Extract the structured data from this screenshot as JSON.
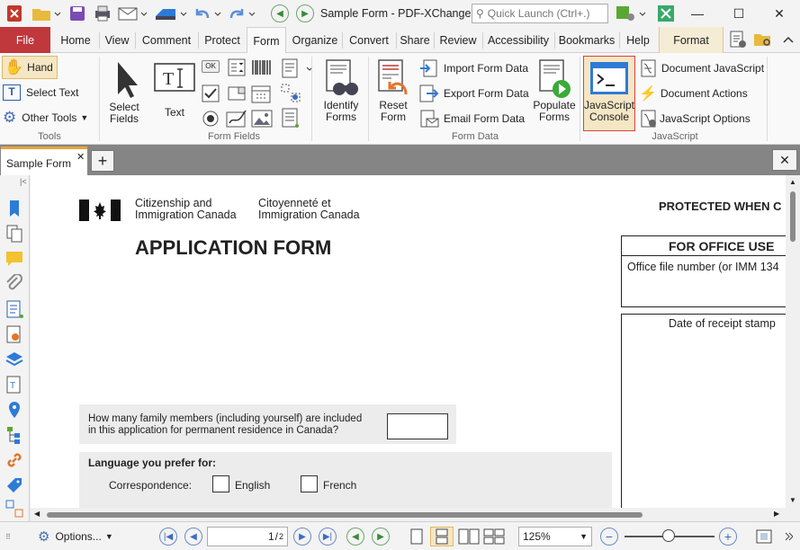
{
  "window": {
    "title": "Sample Form - PDF-XChange ..",
    "search_placeholder": "Quick Launch (Ctrl+.)"
  },
  "menu": {
    "file": "File",
    "home": "Home",
    "view": "View",
    "comment": "Comment",
    "protect": "Protect",
    "form": "Form",
    "organize": "Organize",
    "convert": "Convert",
    "share": "Share",
    "review": "Review",
    "accessibility": "Accessibility",
    "bookmarks": "Bookmarks",
    "help": "Help",
    "format": "Format"
  },
  "ribbon": {
    "tools": {
      "hand": "Hand",
      "select_text": "Select Text",
      "other_tools": "Other Tools",
      "group": "Tools"
    },
    "fields": {
      "select_fields_1": "Select",
      "select_fields_2": "Fields",
      "text": "Text",
      "ok": "OK",
      "group": "Form Fields"
    },
    "identify_1": "Identify",
    "identify_2": "Forms",
    "data": {
      "reset_1": "Reset",
      "reset_2": "Form",
      "import": "Import Form Data",
      "export": "Export Form Data",
      "email": "Email Form Data",
      "populate_1": "Populate",
      "populate_2": "Forms",
      "group": "Form Data"
    },
    "js": {
      "console_1": "JavaScript",
      "console_2": "Console",
      "doc_js": "Document JavaScript",
      "doc_actions": "Document Actions",
      "js_options": "JavaScript Options",
      "group": "JavaScript"
    }
  },
  "tabs": {
    "active": "Sample Form"
  },
  "document": {
    "dept_en_1": "Citizenship and",
    "dept_en_2": "Immigration Canada",
    "dept_fr_1": "Citoyenneté et",
    "dept_fr_2": "Immigration Canada",
    "protected": "PROTECTED WHEN C",
    "app_title": "APPLICATION FORM",
    "office_use": "FOR OFFICE USE",
    "office_file": "Office file number (or IMM 134",
    "receipt": "Date of receipt stamp",
    "family_q_1": "How many family members (including yourself) are included",
    "family_q_2": "in this application for permanent residence in Canada?",
    "lang_title": "Language you prefer for:",
    "correspondence": "Correspondence:",
    "english": "English",
    "french": "French"
  },
  "status": {
    "options": "Options...",
    "page_current": "1",
    "page_total": "2",
    "zoom": "125%"
  }
}
